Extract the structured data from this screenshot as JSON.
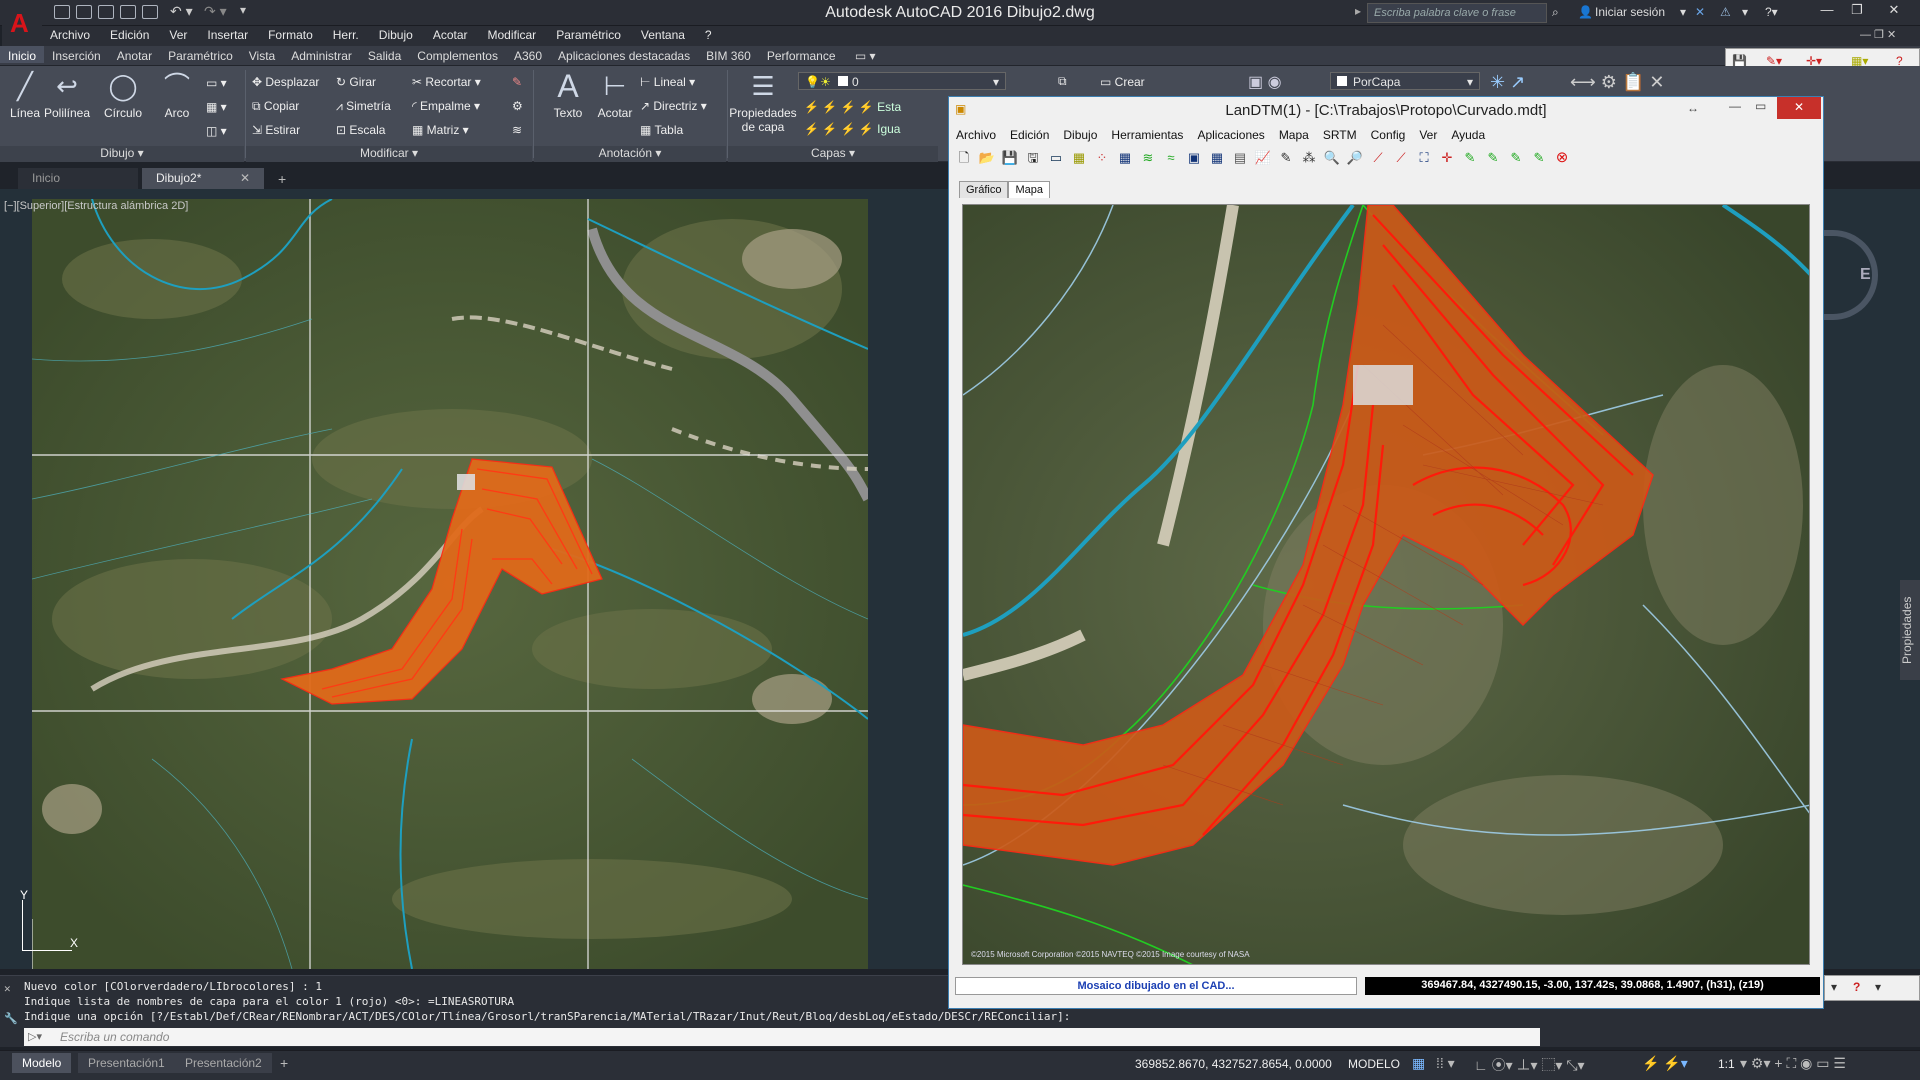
{
  "window": {
    "title": "Autodesk AutoCAD 2016    Dibujo2.dwg",
    "search_placeholder": "Escriba palabra clave o frase",
    "signin": "Iniciar sesión"
  },
  "menu": [
    "Archivo",
    "Edición",
    "Ver",
    "Insertar",
    "Formato",
    "Herr.",
    "Dibujo",
    "Acotar",
    "Modificar",
    "Paramétrico",
    "Ventana",
    "?"
  ],
  "ribbon_tabs": [
    "Inicio",
    "Inserción",
    "Anotar",
    "Paramétrico",
    "Vista",
    "Administrar",
    "Salida",
    "Complementos",
    "A360",
    "Aplicaciones destacadas",
    "BIM 360",
    "Performance"
  ],
  "ribbon": {
    "draw": {
      "linea": "Línea",
      "polilinea": "Polilínea",
      "circulo": "Círculo",
      "arco": "Arco",
      "panel": "Dibujo ▾"
    },
    "modify": {
      "desplazar": "Desplazar",
      "girar": "Girar",
      "recortar": "Recortar ▾",
      "copiar": "Copiar",
      "simetria": "Simetría",
      "empalme": "Empalme ▾",
      "estirar": "Estirar",
      "escala": "Escala",
      "matriz": "Matriz ▾",
      "panel": "Modificar ▾"
    },
    "annotation": {
      "texto": "Texto",
      "acotar": "Acotar",
      "lineal": "Lineal ▾",
      "directriz": "Directriz ▾",
      "tabla": "Tabla",
      "panel": "Anotación ▾"
    },
    "layers": {
      "props": "Propiedades de capa",
      "layer": "0",
      "panel": "Capas ▾",
      "esta": "Esta",
      "igua": "Igua"
    },
    "block": {
      "crear": "Crear"
    },
    "props": {
      "porcapa": "PorCapa"
    }
  },
  "doc_tabs": [
    "Inicio",
    "Dibujo2*"
  ],
  "viewport_label": "[−][Superior][Estructura alámbrica 2D]",
  "compass_e": "E",
  "propiedades": "Propiedades",
  "command": {
    "lines": [
      "Nuevo color [COlorverdadero/LIbrocolores] : 1",
      "Indique lista de nombres de capa para el color 1 (rojo) <0>: =LINEASROTURA",
      "Indique una opción [?/Establ/Def/CRear/RENombrar/ACT/DES/COlor/Tlínea/Grosorl/tranSParencia/MATerial/TRazar/Inut/Reut/Bloq/desbLoq/eEstado/DESCr/REConciliar]:"
    ],
    "placeholder": "Escriba un comando"
  },
  "status": {
    "tabs": [
      "Modelo",
      "Presentación1",
      "Presentación2"
    ],
    "coords": "369852.8670, 4327527.8654, 0.0000",
    "modelo": "MODELO",
    "scale": "1:1"
  },
  "landtm": {
    "title": "LanDTM(1) - [C:\\Trabajos\\Protopo\\Curvado.mdt]",
    "menu": [
      "Archivo",
      "Edición",
      "Dibujo",
      "Herramientas",
      "Aplicaciones",
      "Mapa",
      "SRTM",
      "Config",
      "Ver",
      "Ayuda"
    ],
    "tabs": [
      "Gráfico",
      "Mapa"
    ],
    "copyright": "©2015 Microsoft Corporation ©2015 NAVTEQ ©2015 Image courtesy of NASA",
    "status_msg": "Mosaico dibujado en el CAD...",
    "coords": "369467.84, 4327490.15, -3.00, 137.42s, 39.0868, 1.4907, (h31), (z19)"
  },
  "colors": {
    "accent": "#d8141a",
    "contour_red": "#ff2a14",
    "contour_orange": "#e07a1a",
    "cyan_line": "#1e9fbf",
    "green_line": "#22cc22"
  }
}
